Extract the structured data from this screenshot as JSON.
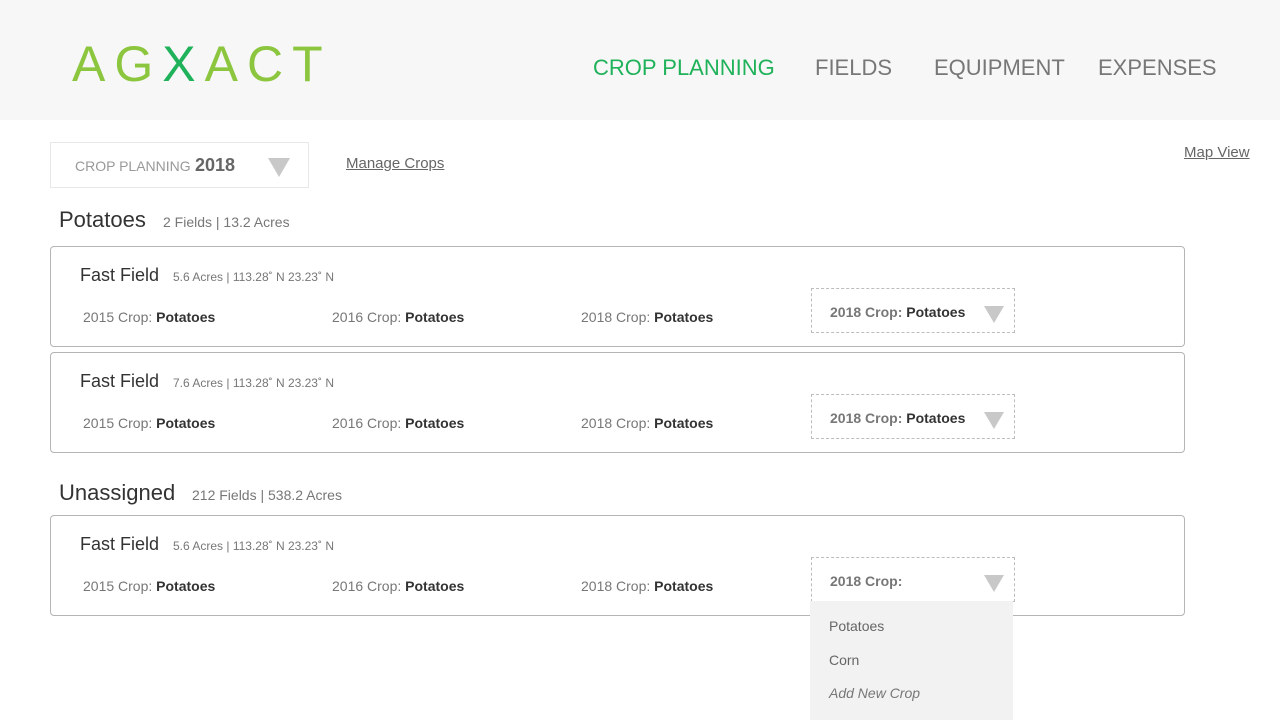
{
  "header": {
    "logo_pre": "AG",
    "logo_x": "X",
    "logo_post": "ACT",
    "nav": {
      "crop_planning": "CROP PLANNING",
      "fields": "FIELDS",
      "equipment": "EQUIPMENT",
      "expenses": "EXPENSES"
    },
    "active_nav": "crop_planning"
  },
  "toolbar": {
    "select_label": "CROP PLANNING",
    "select_value": "2018",
    "manage_crops": "Manage Crops",
    "map_view": "Map View"
  },
  "groups": [
    {
      "title": "Potatoes",
      "meta": "2 Fields | 13.2 Acres",
      "fields": [
        {
          "name": "Fast Field",
          "meta": "5.6 Acres  |  113.28˚ N 23.23˚ N",
          "history": [
            {
              "label": "2015 Crop: ",
              "value": "Potatoes"
            },
            {
              "label": "2016 Crop: ",
              "value": "Potatoes"
            },
            {
              "label": "2018 Crop: ",
              "value": "Potatoes"
            }
          ],
          "select_label": "2018 Crop: ",
          "select_value": "Potatoes"
        },
        {
          "name": "Fast Field",
          "meta": "7.6 Acres  |  113.28˚ N 23.23˚ N",
          "history": [
            {
              "label": "2015 Crop: ",
              "value": "Potatoes"
            },
            {
              "label": "2016 Crop: ",
              "value": "Potatoes"
            },
            {
              "label": "2018 Crop: ",
              "value": "Potatoes"
            }
          ],
          "select_label": "2018 Crop: ",
          "select_value": "Potatoes"
        }
      ]
    },
    {
      "title": "Unassigned",
      "meta": "212 Fields | 538.2 Acres",
      "fields": [
        {
          "name": "Fast Field",
          "meta": "5.6 Acres  |  113.28˚ N 23.23˚ N",
          "history": [
            {
              "label": "2015 Crop: ",
              "value": "Potatoes"
            },
            {
              "label": "2016 Crop: ",
              "value": "Potatoes"
            },
            {
              "label": "2018 Crop: ",
              "value": "Potatoes"
            }
          ],
          "select_label": "2018 Crop:",
          "select_value": ""
        }
      ]
    }
  ],
  "dropdown": {
    "options": [
      "Potatoes",
      "Corn"
    ],
    "add_new": "Add New Crop"
  },
  "colors": {
    "brand_light_green": "#8cc63f",
    "brand_green": "#1fb25a",
    "header_bg": "#f7f7f7"
  }
}
